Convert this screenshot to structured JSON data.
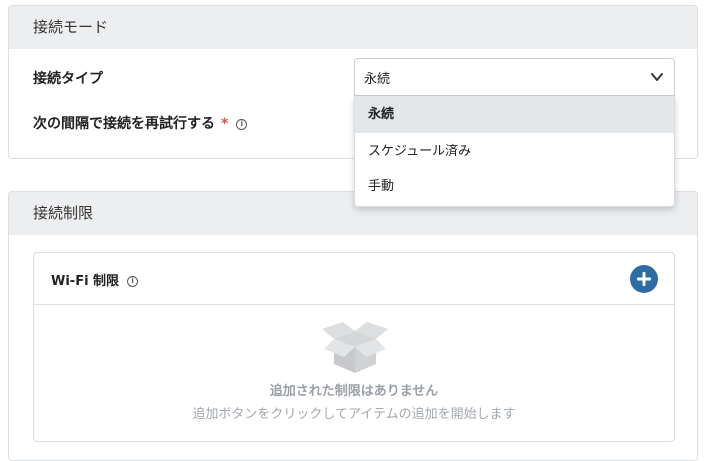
{
  "connection_mode": {
    "header": "接続モード",
    "connection_type_label": "接続タイプ",
    "retry_label": "次の間隔で接続を再試行する",
    "required_mark": "*",
    "info_glyph": "i",
    "dropdown": {
      "selected_value": "永続",
      "options": [
        "永続",
        "スケジュール済み",
        "手動"
      ],
      "highlighted_index": 0
    }
  },
  "connection_limits": {
    "header": "接続制限",
    "wifi": {
      "title": "Wi-Fi 制限",
      "info_glyph": "i",
      "empty_title": "追加された制限はありません",
      "empty_subtitle": "追加ボタンをクリックしてアイテムの追加を開始します"
    }
  },
  "colors": {
    "accent": "#2e6da4",
    "header_bg": "#eceef0",
    "required": "#d9534f"
  }
}
